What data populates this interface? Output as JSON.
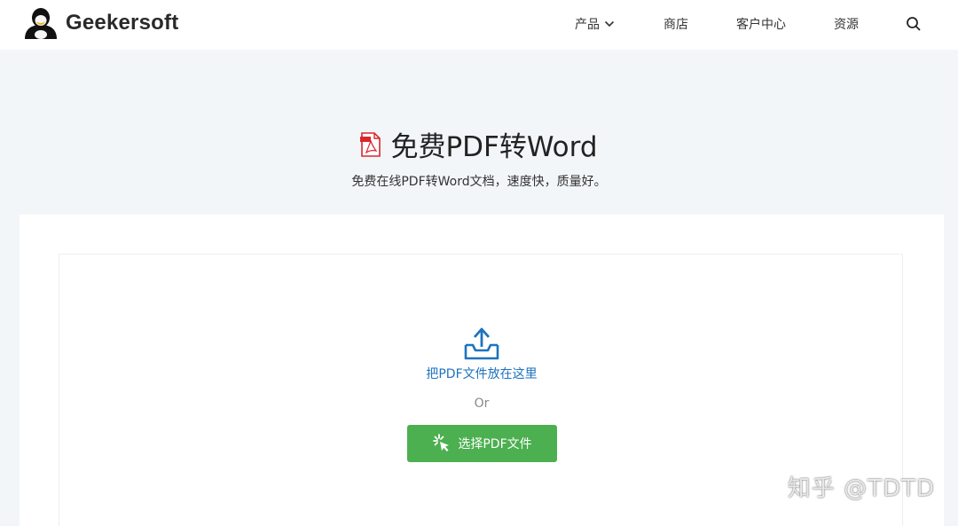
{
  "header": {
    "logo_text": "Geekersoft",
    "nav": {
      "products": "产品",
      "store": "商店",
      "customer_center": "客户中心",
      "resources": "资源"
    }
  },
  "hero": {
    "title": "免费PDF转Word",
    "subtitle": "免费在线PDF转Word文档，速度快，质量好。"
  },
  "upload": {
    "drop_text": "把PDF文件放在这里",
    "or_text": "Or",
    "select_button": "选择PDF文件"
  },
  "watermark": "知乎 @TDTD",
  "colors": {
    "accent_green": "#4caf50",
    "link_blue": "#1e73be",
    "pdf_red": "#d9262c",
    "background": "#f3f6f9"
  },
  "icons": {
    "logo": "penguin-logo-icon",
    "products_dropdown": "chevron-down-icon",
    "search": "search-icon",
    "pdf": "pdf-file-icon",
    "upload": "upload-tray-icon",
    "select": "click-cursor-icon"
  }
}
